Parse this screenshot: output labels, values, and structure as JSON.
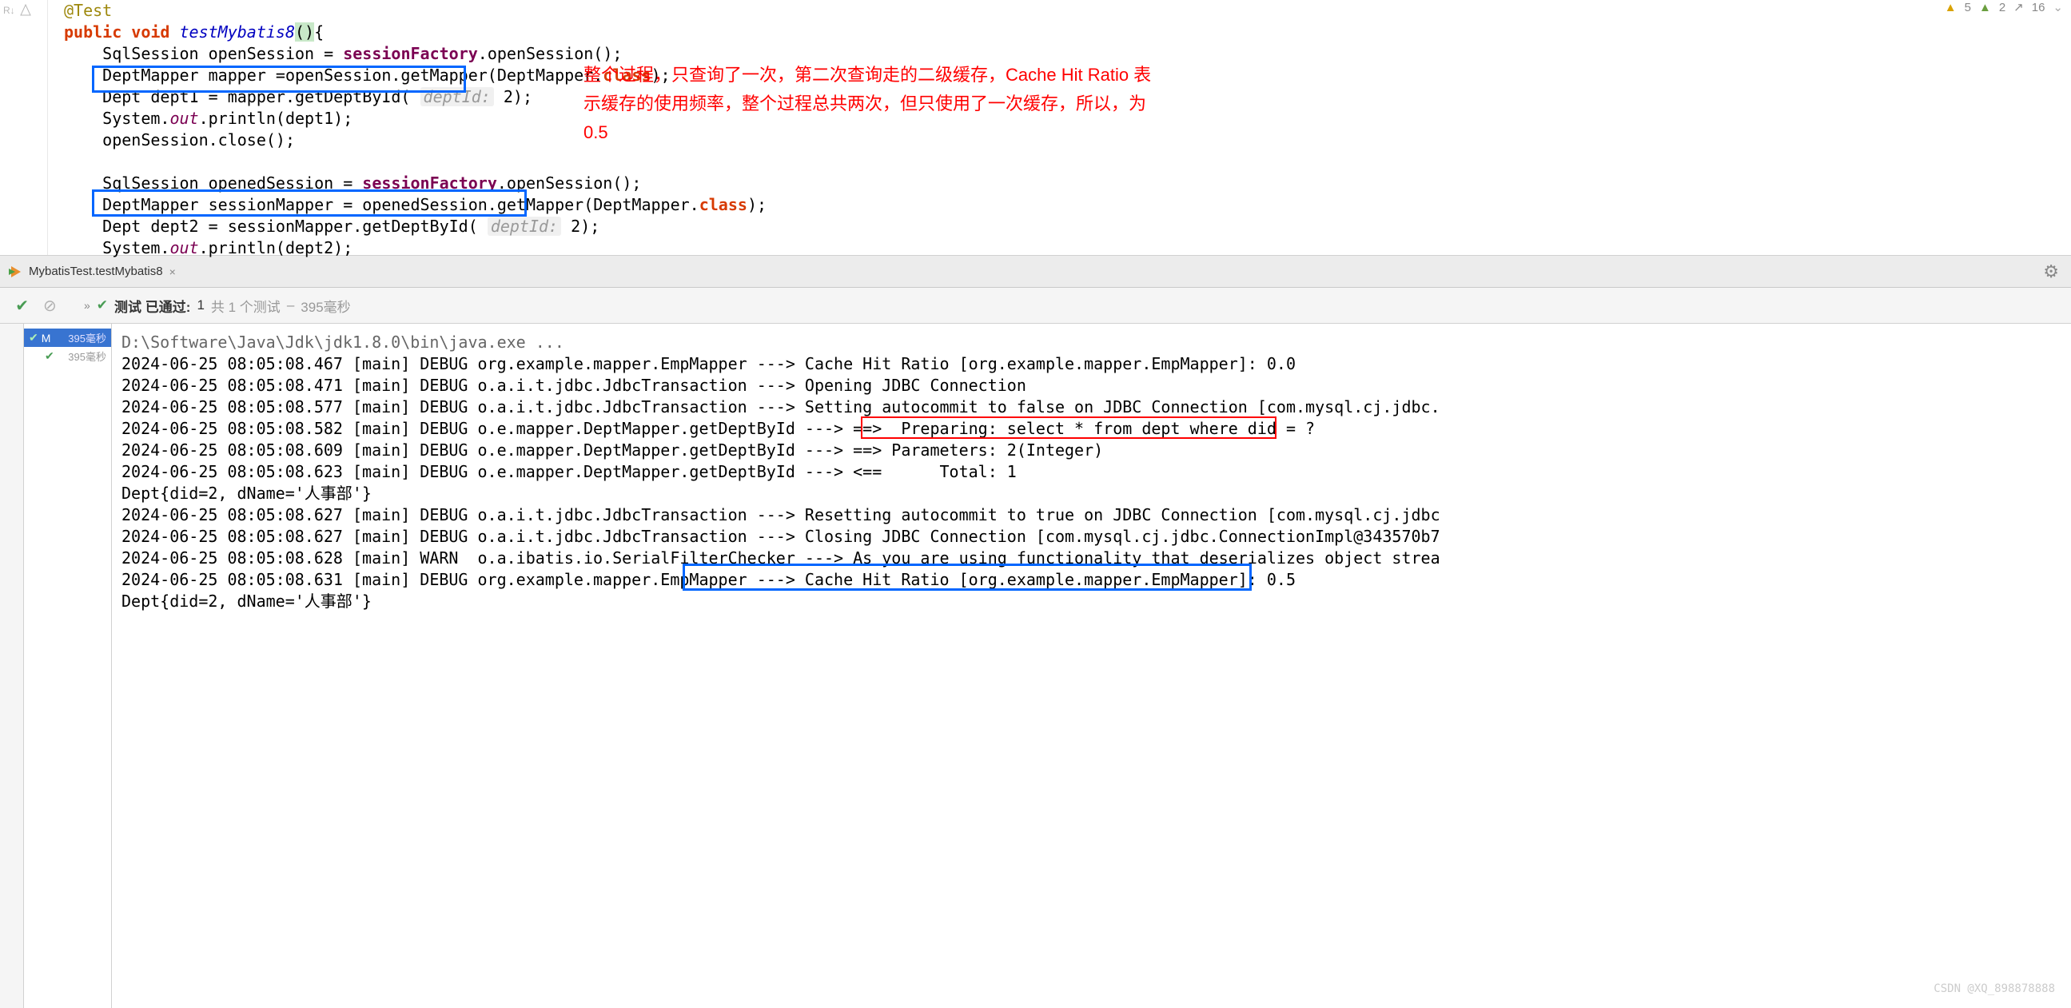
{
  "warnings": {
    "yellow": "5",
    "green": "2",
    "arrow": "16"
  },
  "code": {
    "annotation": "@Test",
    "l1_kw1": "public",
    "l1_kw2": "void",
    "l1_method": "testMybatis8",
    "l2": "    SqlSession openSession = ",
    "l2_field": "sessionFactory",
    "l2_rest": ".openSession();",
    "l3": "    DeptMapper mapper =openSession.getMapper(DeptMapper.",
    "l3_kw": "class",
    "l3_end": ");",
    "l4": "    Dept dept1 = mapper.getDeptById( ",
    "l4_hint": "deptId:",
    "l4_val": " 2);",
    "l5a": "    System.",
    "l5b": "out",
    "l5c": ".println(dept1);",
    "l6": "    openSession.close();",
    "l7": "    SqlSession openedSession = ",
    "l7_field": "sessionFactory",
    "l7_rest": ".openSession();",
    "l8": "    DeptMapper sessionMapper = openedSession.getMapper(DeptMapper.",
    "l8_kw": "class",
    "l8_end": ");",
    "l9": "    Dept dept2 = sessionMapper.getDeptById( ",
    "l9_hint": "deptId:",
    "l9_val": " 2);",
    "l10a": "    System.",
    "l10b": "out",
    "l10c": ".println(dept2);"
  },
  "annotation_text": "整个过程，只查询了一次，第二次查询走的二级缓存，Cache Hit Ratio 表示缓存的使用频率，整个过程总共两次，但只使用了一次缓存，所以，为0.5",
  "run_tab": "MybatisTest.testMybatis8",
  "test_status": {
    "label": "测试 已通过:",
    "passed": "1",
    "total_label": "共 1 个测试",
    "time": "395毫秒"
  },
  "test_tree": {
    "name": "M",
    "time": "395毫秒",
    "sub_time": "395毫秒"
  },
  "console": {
    "cmd": "D:\\Software\\Java\\Jdk\\jdk1.8.0\\bin\\java.exe ...",
    "l1": "2024-06-25 08:05:08.467 [main] DEBUG org.example.mapper.EmpMapper ---> Cache Hit Ratio [org.example.mapper.EmpMapper]: 0.0",
    "l2": "2024-06-25 08:05:08.471 [main] DEBUG o.a.i.t.jdbc.JdbcTransaction ---> Opening JDBC Connection",
    "l3": "2024-06-25 08:05:08.577 [main] DEBUG o.a.i.t.jdbc.JdbcTransaction ---> Setting autocommit to false on JDBC Connection [com.mysql.cj.jdbc.",
    "l4": "2024-06-25 08:05:08.582 [main] DEBUG o.e.mapper.DeptMapper.getDeptById ---> ==>  Preparing: select * from dept where did = ?",
    "l5": "2024-06-25 08:05:08.609 [main] DEBUG o.e.mapper.DeptMapper.getDeptById ---> ==> Parameters: 2(Integer)",
    "l6": "2024-06-25 08:05:08.623 [main] DEBUG o.e.mapper.DeptMapper.getDeptById ---> <==      Total: 1",
    "l7": "Dept{did=2, dName='人事部'}",
    "l8": "2024-06-25 08:05:08.627 [main] DEBUG o.a.i.t.jdbc.JdbcTransaction ---> Resetting autocommit to true on JDBC Connection [com.mysql.cj.jdbc",
    "l9": "2024-06-25 08:05:08.627 [main] DEBUG o.a.i.t.jdbc.JdbcTransaction ---> Closing JDBC Connection [com.mysql.cj.jdbc.ConnectionImpl@343570b7",
    "l10": "2024-06-25 08:05:08.628 [main] WARN  o.a.ibatis.io.SerialFilterChecker ---> As you are using functionality that deserializes object strea",
    "l11": "2024-06-25 08:05:08.631 [main] DEBUG org.example.mapper.EmpMapper ---> Cache Hit Ratio [org.example.mapper.EmpMapper]: 0.5",
    "l12": "Dept{did=2, dName='人事部'}"
  },
  "watermark": "CSDN @XQ_898878888"
}
